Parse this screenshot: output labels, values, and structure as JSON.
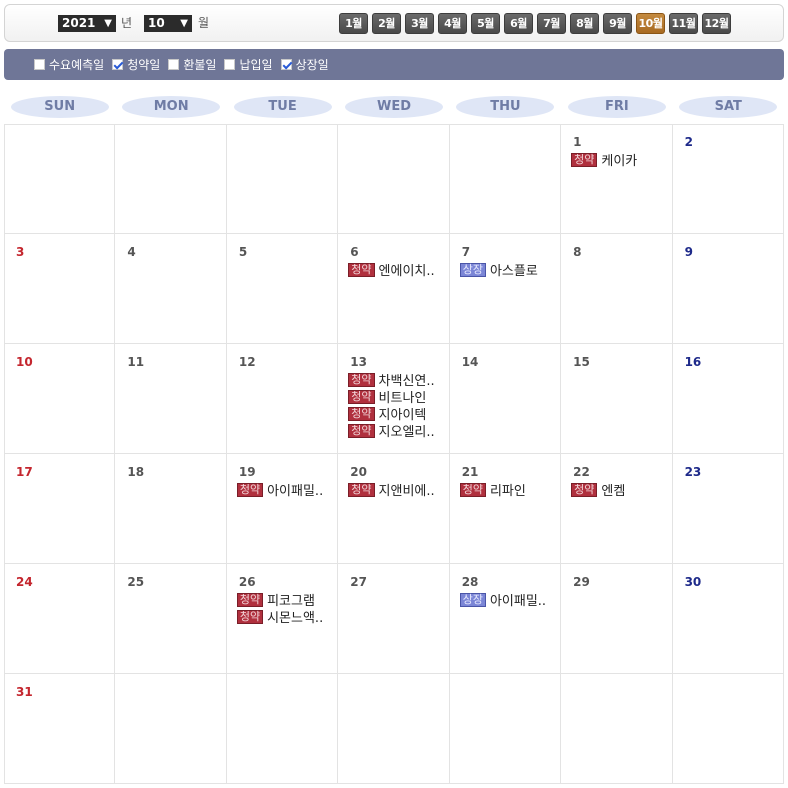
{
  "selectors": {
    "year": "2021",
    "year_suffix": "년",
    "month": "10",
    "month_suffix": "월"
  },
  "month_buttons": [
    "1월",
    "2월",
    "3월",
    "4월",
    "5월",
    "6월",
    "7월",
    "8월",
    "9월",
    "10월",
    "11월",
    "12월"
  ],
  "active_month_index": 9,
  "filters": [
    {
      "label": "수요예측일",
      "checked": false
    },
    {
      "label": "청약일",
      "checked": true
    },
    {
      "label": "환불일",
      "checked": false
    },
    {
      "label": "납입일",
      "checked": false
    },
    {
      "label": "상장일",
      "checked": true
    }
  ],
  "weekdays": [
    "SUN",
    "MON",
    "TUE",
    "WED",
    "THU",
    "FRI",
    "SAT"
  ],
  "tags": {
    "sub": "청약",
    "list": "상장"
  },
  "weeks": [
    [
      null,
      null,
      null,
      null,
      null,
      {
        "day": "1",
        "events": [
          {
            "tag": "sub",
            "name": "케이카"
          }
        ]
      },
      {
        "day": "2",
        "events": []
      }
    ],
    [
      {
        "day": "3",
        "events": []
      },
      {
        "day": "4",
        "events": []
      },
      {
        "day": "5",
        "events": []
      },
      {
        "day": "6",
        "events": [
          {
            "tag": "sub",
            "name": "엔에이치.."
          }
        ]
      },
      {
        "day": "7",
        "events": [
          {
            "tag": "list",
            "name": "아스플로"
          }
        ]
      },
      {
        "day": "8",
        "events": []
      },
      {
        "day": "9",
        "events": []
      }
    ],
    [
      {
        "day": "10",
        "events": []
      },
      {
        "day": "11",
        "events": []
      },
      {
        "day": "12",
        "events": []
      },
      {
        "day": "13",
        "events": [
          {
            "tag": "sub",
            "name": "차백신연.."
          },
          {
            "tag": "sub",
            "name": "비트나인"
          },
          {
            "tag": "sub",
            "name": "지아이텍"
          },
          {
            "tag": "sub",
            "name": "지오엘리.."
          }
        ]
      },
      {
        "day": "14",
        "events": []
      },
      {
        "day": "15",
        "events": []
      },
      {
        "day": "16",
        "events": []
      }
    ],
    [
      {
        "day": "17",
        "events": []
      },
      {
        "day": "18",
        "events": []
      },
      {
        "day": "19",
        "events": [
          {
            "tag": "sub",
            "name": "아이패밀.."
          }
        ]
      },
      {
        "day": "20",
        "events": [
          {
            "tag": "sub",
            "name": "지앤비에.."
          }
        ]
      },
      {
        "day": "21",
        "events": [
          {
            "tag": "sub",
            "name": "리파인"
          }
        ]
      },
      {
        "day": "22",
        "events": [
          {
            "tag": "sub",
            "name": "엔켐"
          }
        ]
      },
      {
        "day": "23",
        "events": []
      }
    ],
    [
      {
        "day": "24",
        "events": []
      },
      {
        "day": "25",
        "events": []
      },
      {
        "day": "26",
        "events": [
          {
            "tag": "sub",
            "name": "피코그램"
          },
          {
            "tag": "sub",
            "name": "시몬느액.."
          }
        ]
      },
      {
        "day": "27",
        "events": []
      },
      {
        "day": "28",
        "events": [
          {
            "tag": "list",
            "name": "아이패밀.."
          }
        ]
      },
      {
        "day": "29",
        "events": []
      },
      {
        "day": "30",
        "events": []
      }
    ],
    [
      {
        "day": "31",
        "events": []
      },
      null,
      null,
      null,
      null,
      null,
      null
    ]
  ],
  "colors": {
    "sunday": "#c4262e",
    "saturday": "#1e2a8a",
    "active_month": "#b87a30",
    "filter_bar": "#6f7697"
  }
}
